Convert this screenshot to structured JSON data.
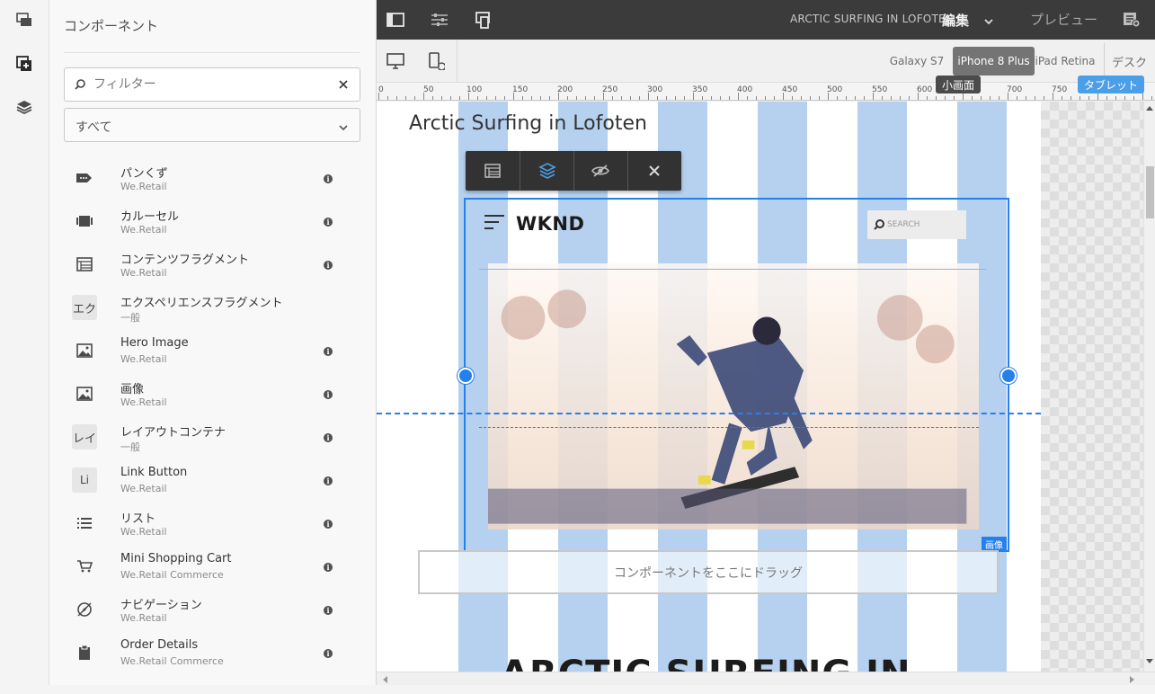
{
  "side_panel": {
    "title": "コンポーネント",
    "filter_placeholder": "フィルター",
    "group_select_value": "すべて",
    "items": [
      {
        "name": "パンくず",
        "group": "We.Retail",
        "icon": "breadcrumb-icon",
        "info": true
      },
      {
        "name": "カルーセル",
        "group": "We.Retail",
        "icon": "carousel-icon",
        "info": true
      },
      {
        "name": "コンテンツフラグメント",
        "group": "We.Retail",
        "icon": "content-fragment-icon",
        "info": true
      },
      {
        "name": "エクスペリエンスフラグメント",
        "group": "一般",
        "icon_text": "エク",
        "info": false
      },
      {
        "name": "Hero Image",
        "group": "We.Retail",
        "icon": "image-icon",
        "info": true
      },
      {
        "name": "画像",
        "group": "We.Retail",
        "icon": "image-icon",
        "info": true
      },
      {
        "name": "レイアウトコンテナ",
        "group": "一般",
        "icon_text": "レイ",
        "info": true
      },
      {
        "name": "Link Button",
        "group": "We.Retail",
        "icon_text": "Li",
        "info": true
      },
      {
        "name": "リスト",
        "group": "We.Retail",
        "icon": "list-icon",
        "info": true
      },
      {
        "name": "Mini Shopping Cart",
        "group": "We.Retail Commerce",
        "icon": "cart-icon",
        "info": true
      },
      {
        "name": "ナビゲーション",
        "group": "We.Retail",
        "icon": "navigation-icon",
        "info": true
      },
      {
        "name": "Order Details",
        "group": "We.Retail Commerce",
        "icon": "clipboard-icon",
        "info": true
      }
    ]
  },
  "header": {
    "page_title": "ARCTIC SURFING IN LOFOTEN",
    "mode": "編集",
    "preview": "プレビュー"
  },
  "emulator": {
    "devices": [
      "Galaxy S7",
      "iPhone 8 Plus",
      "iPad Retina",
      "デスク"
    ],
    "active_device": "iPhone 8 Plus"
  },
  "ruler": {
    "ticks": [
      "0",
      "50",
      "100",
      "150",
      "200",
      "250",
      "300",
      "350",
      "400",
      "450",
      "500",
      "550",
      "600",
      "650",
      "700",
      "750"
    ],
    "breakpoint_small": "小画面",
    "breakpoint_tablet": "タブレット"
  },
  "canvas": {
    "page_heading": "Arctic Surfing in Lofoten",
    "hero_logo": "WKND",
    "hero_search": "SEARCH",
    "component_badge": "画像",
    "dropzone": "コンポーネントをここにドラッグ",
    "big_heading": "ARCTIC SURFING IN"
  },
  "colors": {
    "accent": "#2680eb",
    "topbar": "#3b3b3b",
    "grid": "#78ace2"
  }
}
